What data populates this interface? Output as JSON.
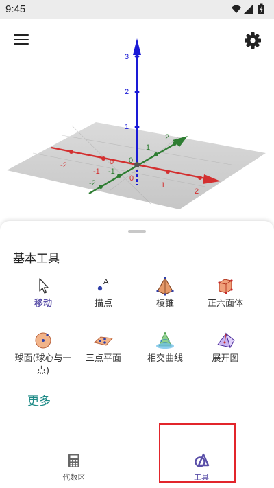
{
  "status_bar": {
    "time": "9:45",
    "icons": [
      "wifi-icon",
      "signal-icon",
      "battery-charging-icon"
    ]
  },
  "graphics": {
    "axes_colors": {
      "x": "#d32f2f",
      "y": "#2e7d32",
      "z": "#1a1ad6"
    },
    "z_ticks": [
      "1",
      "2",
      "3"
    ],
    "x_ticks": [
      "-2",
      "-1",
      "1",
      "2"
    ],
    "y_ticks": [
      "-2",
      "-1",
      "1",
      "2"
    ],
    "origin_labels": [
      "0",
      "0",
      "0"
    ]
  },
  "toolbar": {
    "menu_icon": "hamburger-menu-icon",
    "settings_icon": "gear-icon"
  },
  "tools_panel": {
    "title": "基本工具",
    "tools": [
      {
        "label": "移动",
        "icon": "arrow-cursor-icon",
        "selected": true
      },
      {
        "label": "描点",
        "icon": "point-icon",
        "selected": false
      },
      {
        "label": "棱锥",
        "icon": "pyramid-icon",
        "selected": false
      },
      {
        "label": "正六面体",
        "icon": "cube-icon",
        "selected": false
      },
      {
        "label": "球面(球心与一点)",
        "label_line1": "球面(球心与一",
        "label_line2": "点)",
        "icon": "sphere-icon",
        "selected": false
      },
      {
        "label": "三点平面",
        "icon": "plane-three-points-icon",
        "selected": false
      },
      {
        "label": "相交曲线",
        "icon": "intersection-curve-icon",
        "selected": false
      },
      {
        "label": "展开图",
        "icon": "net-icon",
        "selected": false
      }
    ],
    "more_label": "更多"
  },
  "bottom_nav": {
    "tabs": [
      {
        "label": "代数区",
        "icon": "calculator-icon",
        "active": false
      },
      {
        "label": "工具",
        "icon": "tools-icon",
        "active": true
      }
    ]
  },
  "colors": {
    "accent": "#5a4fa8",
    "more_link": "#1d8a86",
    "highlight": "#e2252b"
  }
}
